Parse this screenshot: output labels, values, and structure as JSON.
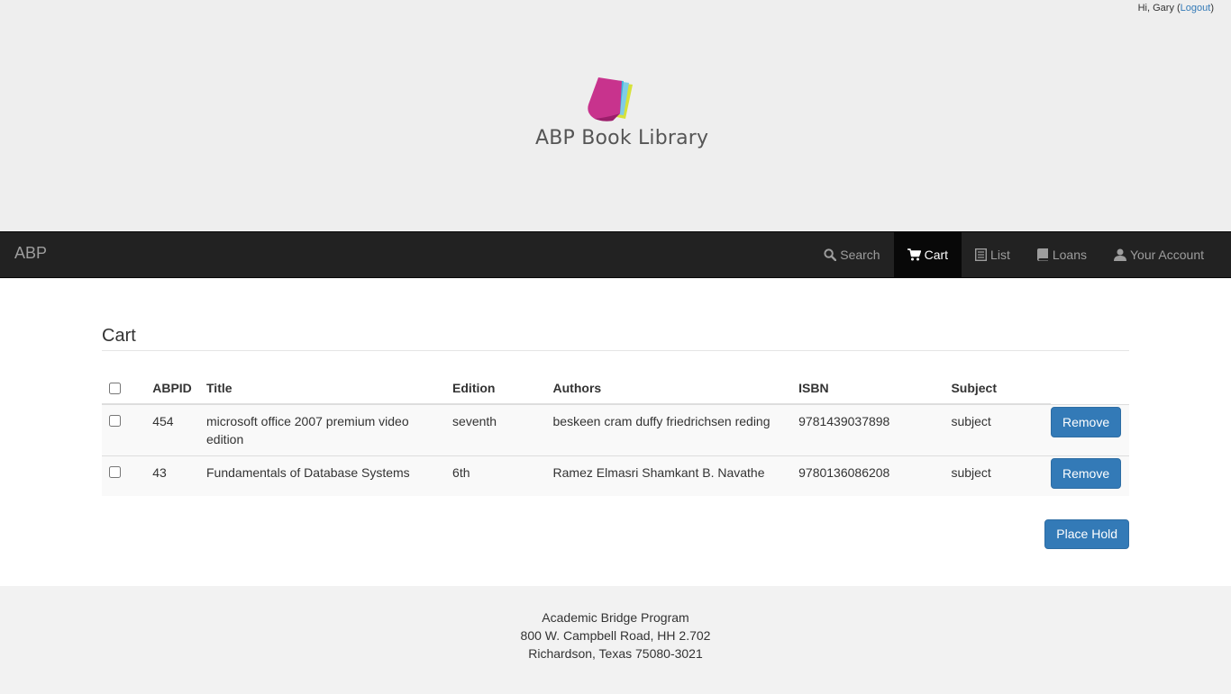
{
  "header": {
    "greeting_prefix": "Hi, Gary (",
    "logout_label": "Logout",
    "greeting_suffix": ")",
    "logo_text": "ABP Book Library"
  },
  "navbar": {
    "brand": "ABP",
    "items": [
      {
        "label": "Search",
        "icon": "search-icon"
      },
      {
        "label": "Cart",
        "icon": "shopping-cart-icon",
        "active": true
      },
      {
        "label": "List",
        "icon": "list-icon"
      },
      {
        "label": "Loans",
        "icon": "book-icon"
      },
      {
        "label": "Your Account",
        "icon": "user-icon"
      }
    ]
  },
  "cart": {
    "title": "Cart",
    "columns": [
      "ABPID",
      "Title",
      "Edition",
      "Authors",
      "ISBN",
      "Subject"
    ],
    "rows": [
      {
        "abpid": "454",
        "title": "microsoft office 2007 premium video edition",
        "edition": "seventh",
        "authors": "beskeen cram duffy friedrichsen reding",
        "isbn": "9781439037898",
        "subject": "subject",
        "remove_label": "Remove"
      },
      {
        "abpid": "43",
        "title": "Fundamentals of Database Systems",
        "edition": "6th",
        "authors": "Ramez Elmasri Shamkant B. Navathe",
        "isbn": "9780136086208",
        "subject": "subject",
        "remove_label": "Remove"
      }
    ],
    "place_hold_label": "Place Hold"
  },
  "footer": {
    "line1": "Academic Bridge Program",
    "line2": "800 W. Campbell Road, HH 2.702",
    "line3": "Richardson, Texas 75080-3021"
  },
  "colors": {
    "header_bg": "#eeeeee",
    "navbar_bg": "#222222",
    "nav_active_bg": "#080808",
    "primary_button": "#337ab7",
    "link": "#337ab7",
    "footer_bg": "#f2f2f2"
  }
}
